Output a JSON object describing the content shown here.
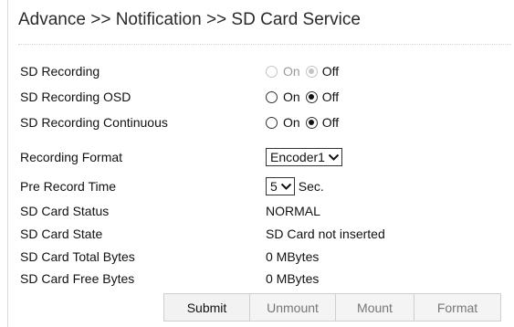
{
  "title": "Advance >> Notification >> SD Card Service",
  "rows": {
    "sd_recording": {
      "label": "SD Recording",
      "on": "On",
      "off": "Off",
      "value": "Off",
      "disabled": true
    },
    "sd_recording_osd": {
      "label": "SD Recording OSD",
      "on": "On",
      "off": "Off",
      "value": "Off"
    },
    "sd_recording_continuous": {
      "label": "SD Recording Continuous",
      "on": "On",
      "off": "Off",
      "value": "Off"
    },
    "recording_format": {
      "label": "Recording Format",
      "value": "Encoder1"
    },
    "pre_record_time": {
      "label": "Pre Record Time",
      "value": "5",
      "unit": "Sec."
    },
    "sd_card_status": {
      "label": "SD Card Status",
      "value": "NORMAL"
    },
    "sd_card_state": {
      "label": "SD Card State",
      "value": "SD Card not inserted"
    },
    "sd_card_total_bytes": {
      "label": "SD Card Total Bytes",
      "value": "0 MBytes"
    },
    "sd_card_free_bytes": {
      "label": "SD Card Free Bytes",
      "value": "0 MBytes"
    }
  },
  "buttons": {
    "submit": "Submit",
    "unmount": "Unmount",
    "mount": "Mount",
    "format": "Format"
  },
  "icons": {
    "dropdown": "chevron-down-icon"
  },
  "colors": {
    "disabled_radio": "#c4c4c4",
    "button_bg": "#f4f4f4",
    "disabled_text": "#777777"
  }
}
